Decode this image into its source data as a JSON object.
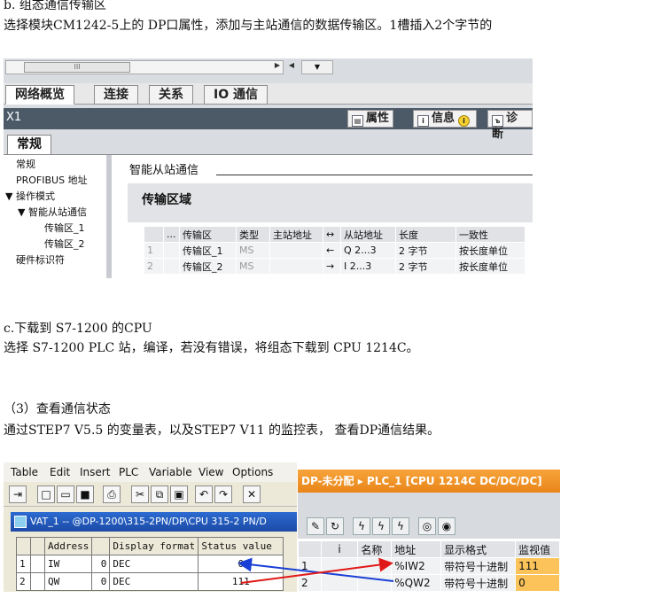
{
  "doc": {
    "line_b_title": "b. 组态通信传输区",
    "line_b_text": "选择模块CM1242-5上的 DP口属性，添加与主站通信的数据传输区。1槽插入2个字节的",
    "line_c_title": "c.下载到 S7-1200 的CPU",
    "line_c_text": "选择 S7-1200 PLC 站，编译，若没有错误，将组态下载到 CPU 1214C。",
    "line_3_title": "（3）查看通信状态",
    "line_3_text": "通过STEP7 V5.5 的变量表，以及STEP7 V11 的监控表， 查看DP通信结果。"
  },
  "shot1": {
    "scroll_grip": "III",
    "tabs": [
      "网络概览",
      "连接",
      "关系",
      "IO 通信"
    ],
    "panel_id": "X1",
    "info_buttons": {
      "props": "属性",
      "info": "信息",
      "diag": "诊断"
    },
    "subtab": "常规",
    "tree": [
      "常规",
      "PROFIBUS 地址",
      "▼ 操作模式",
      "▼ 智能从站通信",
      "传输区_1",
      "传输区_2",
      "硬件标识符"
    ],
    "section": "智能从站通信",
    "area_title": "传输区域",
    "table": {
      "headers": [
        "",
        "...",
        "传输区",
        "类型",
        "主站地址",
        "↔",
        "从站地址",
        "长度",
        "一致性"
      ],
      "rows": [
        [
          "1",
          "",
          "传输区_1",
          "MS",
          "",
          "←",
          "Q 2...3",
          "2 字节",
          "按长度单位"
        ],
        [
          "2",
          "",
          "传输区_2",
          "MS",
          "",
          "→",
          "I 2...3",
          "2 字节",
          "按长度单位"
        ]
      ]
    }
  },
  "shot2": {
    "menu": [
      "Table",
      "Edit",
      "Insert",
      "PLC",
      "Variable",
      "View",
      "Options"
    ],
    "window_title": "VAT_1 -- @DP-1200\\315-2PN/DP\\CPU 315-2 PN/D",
    "headers": [
      "",
      "",
      "Address",
      "",
      "Display format",
      "Status value"
    ],
    "rows": [
      [
        "1",
        "",
        "IW",
        "0",
        "DEC",
        "0"
      ],
      [
        "2",
        "",
        "QW",
        "0",
        "DEC",
        "111"
      ]
    ]
  },
  "shot3": {
    "breadcrumb": "DP-未分配 ▸ PLC_1 [CPU 1214C DC/DC/DC]",
    "headers": [
      "",
      "i",
      "名称",
      "地址",
      "显示格式",
      "监视值"
    ],
    "rows": [
      [
        "1",
        "",
        "",
        "%IW2",
        "带符号十进制",
        "111"
      ],
      [
        "2",
        "",
        "",
        "%QW2",
        "带符号十进制",
        "0"
      ]
    ]
  }
}
